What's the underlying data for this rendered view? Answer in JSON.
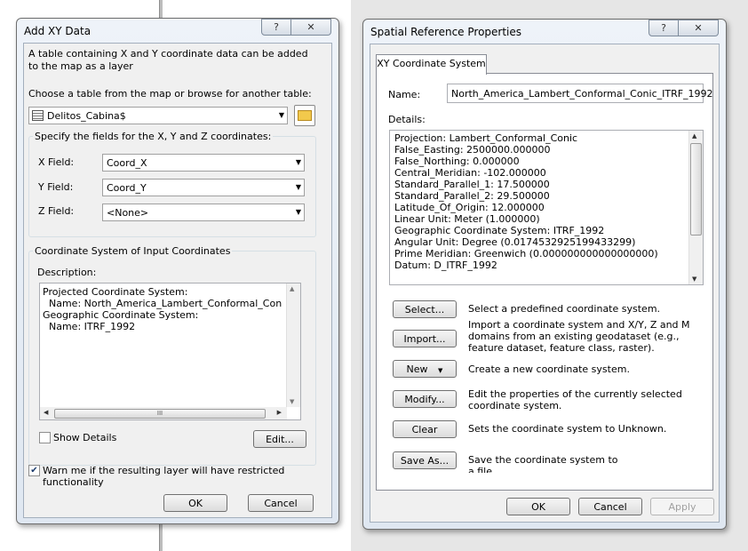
{
  "add_xy": {
    "title": "Add XY Data",
    "help_glyph": "?",
    "close_glyph": "✕",
    "intro": "A table containing X and Y coordinate data can be added to the map as a layer",
    "choose_label": "Choose a table from the map or browse for another table:",
    "table_value": "Delitos_Cabina$",
    "fields_group_label": "Specify the fields for the X, Y and Z coordinates:",
    "x_label": "X Field:",
    "x_value": "Coord_X",
    "y_label": "Y Field:",
    "y_value": "Coord_Y",
    "z_label": "Z Field:",
    "z_value": "<None>",
    "cs_group_label": "Coordinate System of Input Coordinates",
    "description_label": "Description:",
    "description_lines": [
      "Projected Coordinate System:",
      "  Name: North_America_Lambert_Conformal_Conic_ITRI",
      "",
      "Geographic Coordinate System:",
      "  Name: ITRF_1992"
    ],
    "hscroll_grip": "III",
    "show_details_label": "Show Details",
    "edit_label": "Edit...",
    "warn_label": "Warn me if the resulting layer will have restricted functionality",
    "ok_label": "OK",
    "cancel_label": "Cancel"
  },
  "srp": {
    "title": "Spatial Reference Properties",
    "help_glyph": "?",
    "close_glyph": "✕",
    "tab_label": "XY Coordinate System",
    "name_label": "Name:",
    "name_value": "North_America_Lambert_Conformal_Conic_ITRF_1992",
    "details_label": "Details:",
    "details_lines": [
      "Projection: Lambert_Conformal_Conic",
      "False_Easting: 2500000.000000",
      "False_Northing: 0.000000",
      "Central_Meridian: -102.000000",
      "Standard_Parallel_1: 17.500000",
      "Standard_Parallel_2: 29.500000",
      "Latitude_Of_Origin: 12.000000",
      "Linear Unit: Meter (1.000000)",
      "",
      "Geographic Coordinate System: ITRF_1992",
      "Angular Unit: Degree (0.0174532925199433299)",
      "Prime Meridian: Greenwich (0.000000000000000000)",
      "Datum: D_ITRF_1992"
    ],
    "actions": [
      {
        "label": "Select...",
        "desc": "Select a predefined coordinate system."
      },
      {
        "label": "Import...",
        "desc": "Import a coordinate system and X/Y, Z and M domains from an existing geodataset (e.g., feature dataset, feature class, raster)."
      },
      {
        "label": "New",
        "desc": "Create a new coordinate system."
      },
      {
        "label": "Modify...",
        "desc": "Edit the properties of the currently selected coordinate system."
      },
      {
        "label": "Clear",
        "desc": "Sets the coordinate system to Unknown."
      },
      {
        "label": "Save As...",
        "desc": "Save the coordinate system to a file."
      }
    ],
    "ok_label": "OK",
    "cancel_label": "Cancel",
    "apply_label": "Apply"
  }
}
